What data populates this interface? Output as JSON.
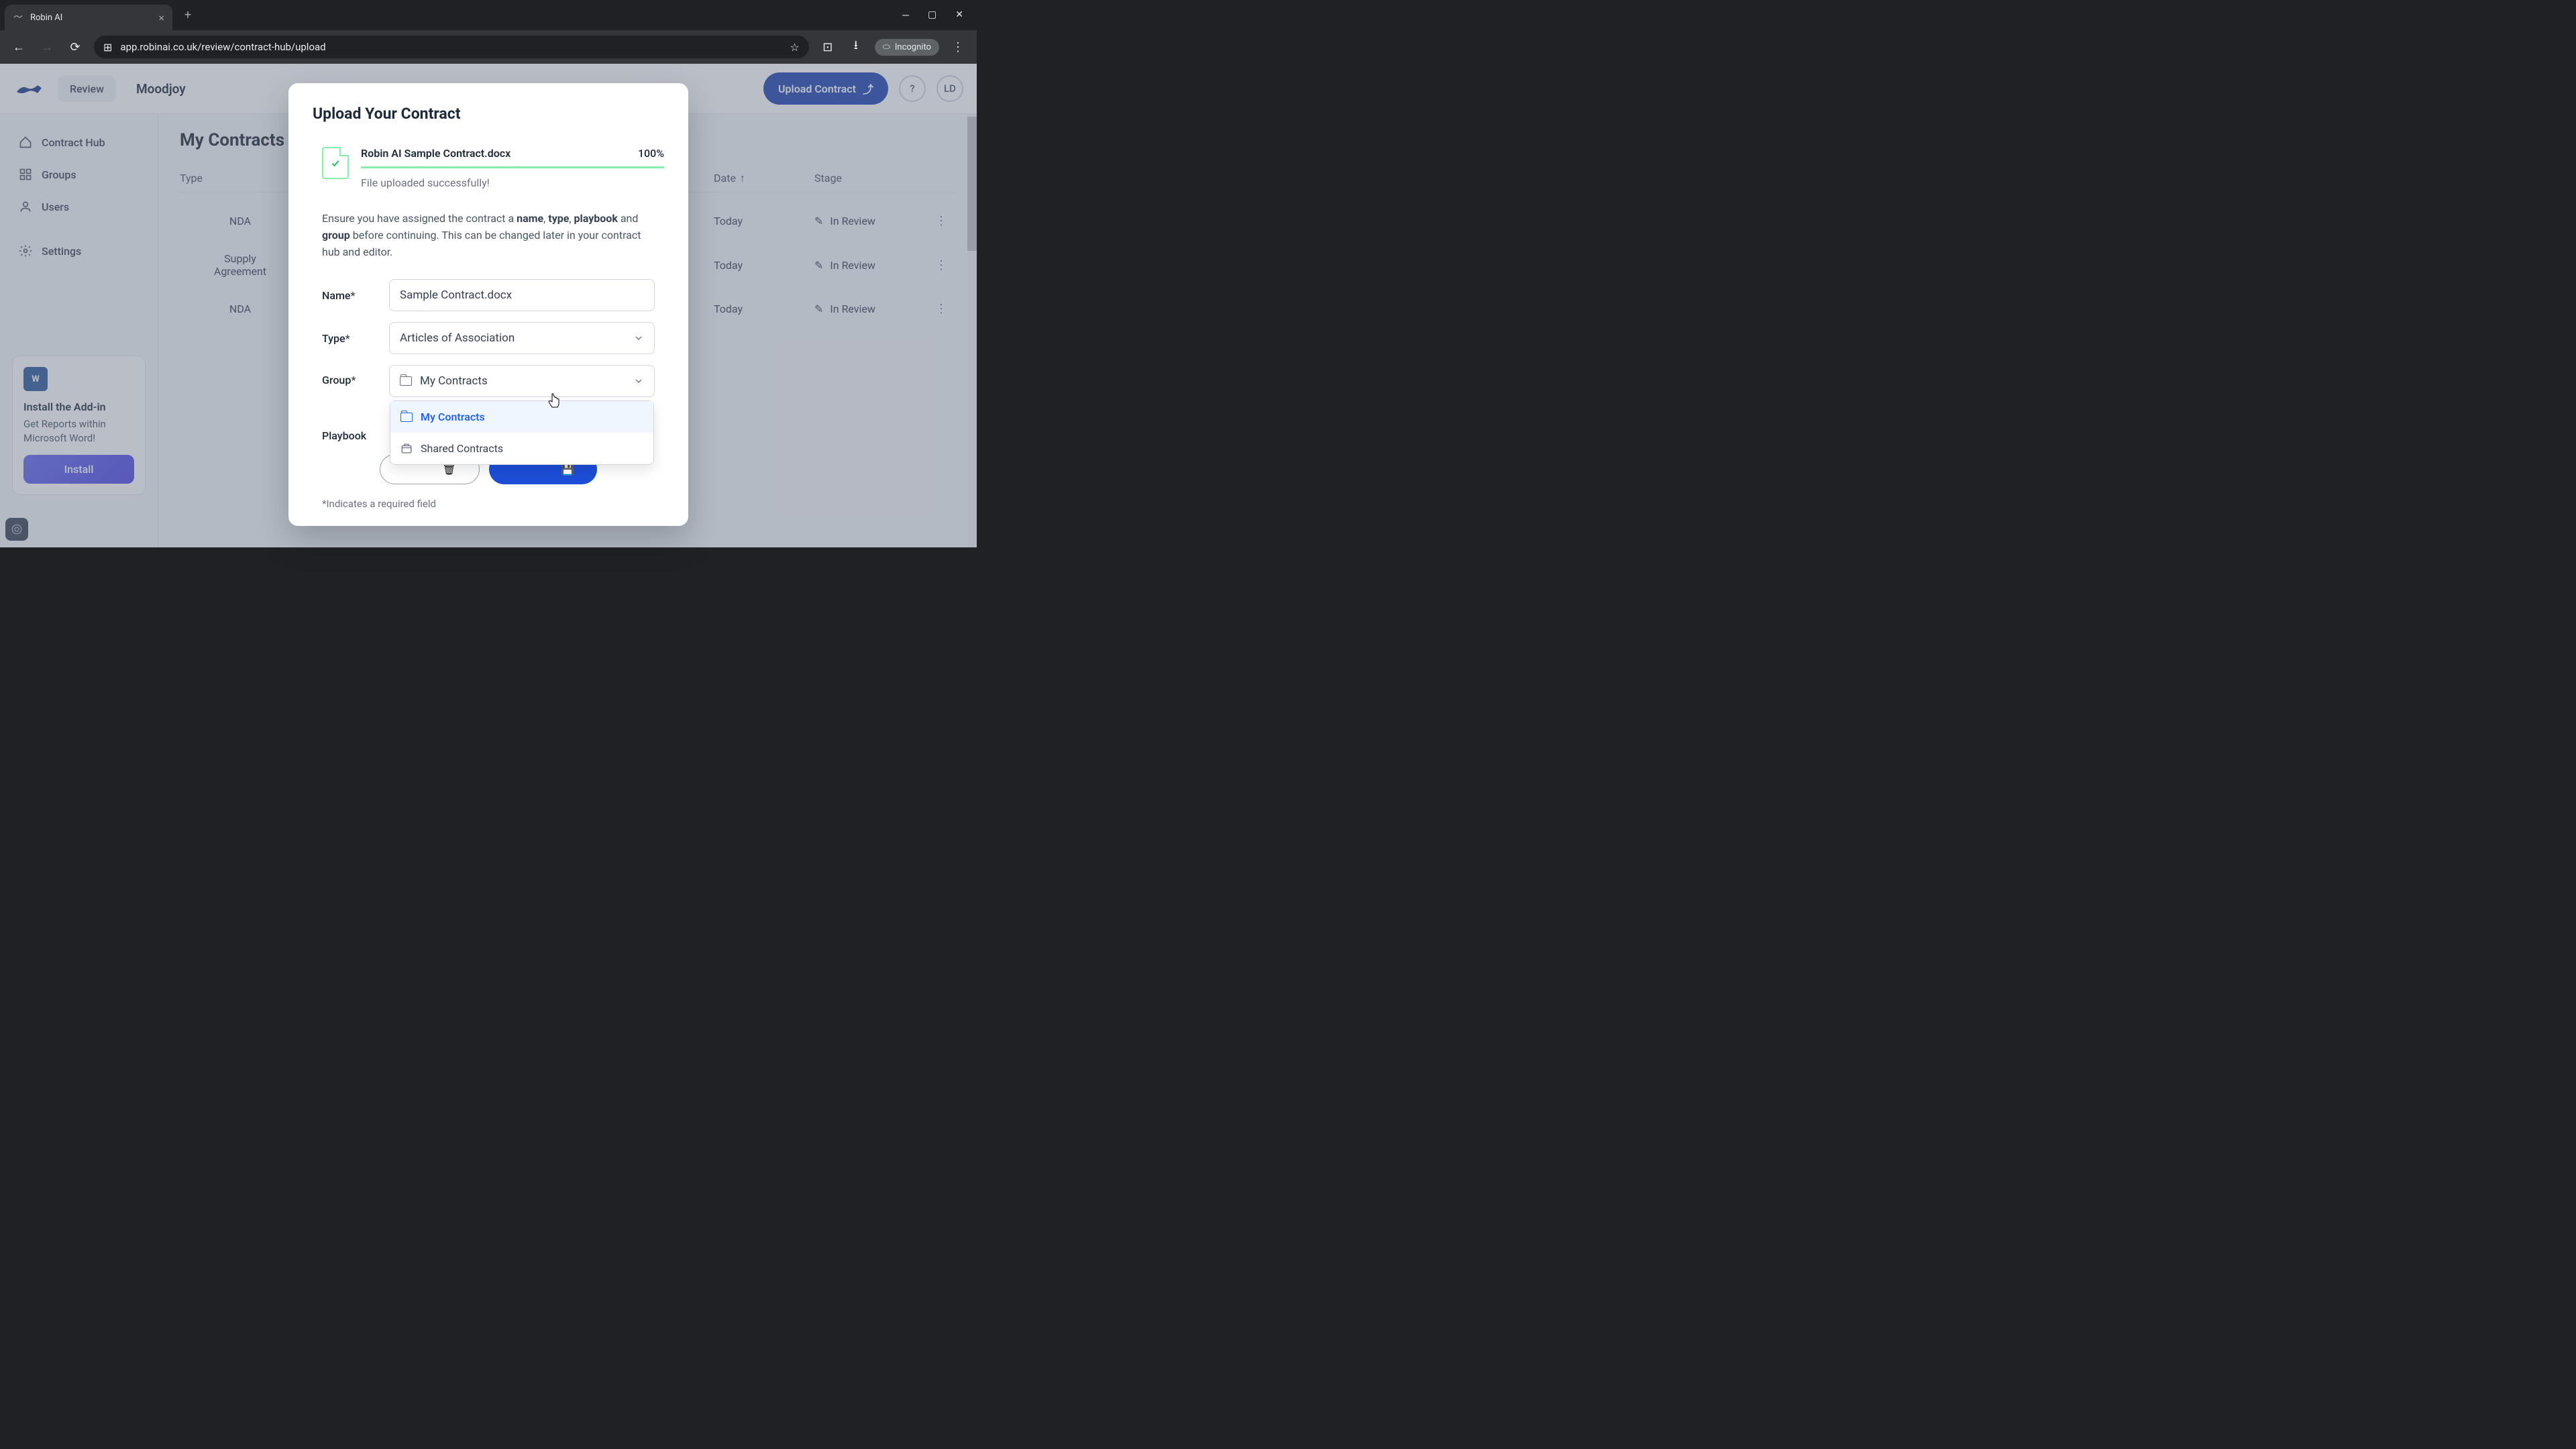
{
  "browser": {
    "tab_title": "Robin AI",
    "url": "app.robinai.co.uk/review/contract-hub/upload",
    "incognito_label": "Incognito"
  },
  "header": {
    "review_label": "Review",
    "workspace": "Moodjoy",
    "upload_button": "Upload Contract",
    "avatar": "LD"
  },
  "sidebar": {
    "items": [
      {
        "label": "Contract Hub"
      },
      {
        "label": "Groups"
      },
      {
        "label": "Users"
      },
      {
        "label": "Settings"
      }
    ],
    "addin": {
      "title": "Install the Add-in",
      "desc": "Get Reports within Microsoft Word!",
      "button": "Install"
    }
  },
  "main": {
    "title": "My Contracts",
    "columns": {
      "type": "Type",
      "date": "Date",
      "stage": "Stage"
    },
    "rows": [
      {
        "type": "NDA",
        "date": "Today",
        "stage": "In Review"
      },
      {
        "type": "Supply Agreement",
        "date": "Today",
        "stage": "In Review"
      },
      {
        "type": "NDA",
        "date": "Today",
        "stage": "In Review"
      }
    ]
  },
  "modal": {
    "title": "Upload Your Contract",
    "file": {
      "name": "Robin AI Sample Contract.docx",
      "percent": "100%",
      "status": "File uploaded successfully!"
    },
    "instruction_pre": "Ensure you have assigned the contract a ",
    "instruction_bold1": "name",
    "instruction_bold2": "type",
    "instruction_bold3": "playbook",
    "instruction_and": " and ",
    "instruction_bold4": "group",
    "instruction_post": " before continuing. This can be changed later in your contract hub and editor.",
    "labels": {
      "name": "Name",
      "type": "Type",
      "group": "Group",
      "playbook": "Playbook"
    },
    "values": {
      "name": "Sample Contract.docx",
      "type": "Articles of Association",
      "group": "My Contracts"
    },
    "group_options": [
      {
        "label": "My Contracts",
        "selected": true
      },
      {
        "label": "Shared Contracts",
        "selected": false
      }
    ],
    "footnote": "*Indicates a required field"
  }
}
